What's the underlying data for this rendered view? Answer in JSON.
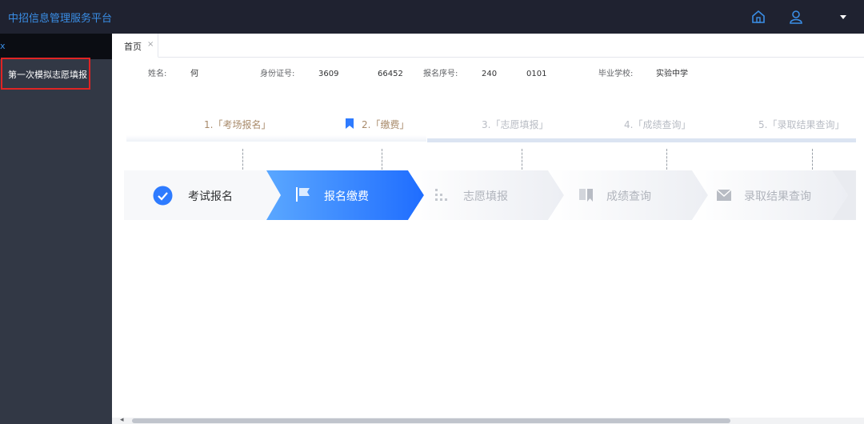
{
  "app": {
    "title": "中招信息管理服务平台"
  },
  "header": {
    "icons": [
      "home-icon",
      "user-icon",
      "caret-down-icon"
    ]
  },
  "sidebar": {
    "collapse_icon": "x",
    "items": [
      {
        "label": "第一次模拟志愿填报",
        "highlighted": true
      }
    ]
  },
  "tabs": [
    {
      "label": "首页",
      "close": "×"
    }
  ],
  "student": {
    "name_label": "姓名:",
    "name_value": "何",
    "id_label": "身份证号:",
    "id_value_1": "3609",
    "id_value_2": "66452",
    "reg_label": "报名序号:",
    "reg_value_1": "240",
    "reg_value_2": "0101",
    "school_label": "毕业学校:",
    "school_value": "实验中学"
  },
  "timeline": {
    "steps": [
      {
        "label": "1.「考场报名」",
        "state": "done"
      },
      {
        "label": "2.「缴费」",
        "state": "active"
      },
      {
        "label": "3.「志愿填报」",
        "state": "pending"
      },
      {
        "label": "4.「成绩查询」",
        "state": "pending"
      },
      {
        "label": "5.「录取结果查询」",
        "state": "pending"
      }
    ]
  },
  "steps_bar": {
    "items": [
      {
        "label": "考试报名",
        "icon": "check-circle-icon",
        "state": "done"
      },
      {
        "label": "报名缴费",
        "icon": "flag-icon",
        "state": "active"
      },
      {
        "label": "志愿填报",
        "icon": "bars-icon",
        "state": "pending"
      },
      {
        "label": "成绩查询",
        "icon": "bookmark-icon",
        "state": "pending"
      },
      {
        "label": "录取结果查询",
        "icon": "mail-icon",
        "state": "pending"
      }
    ]
  },
  "colors": {
    "accent": "#3a8ee6",
    "active_step": "#2e7bff",
    "step_done_text": "#a88a6a",
    "pending": "#b8bcc4",
    "highlight_border": "#e02424"
  }
}
